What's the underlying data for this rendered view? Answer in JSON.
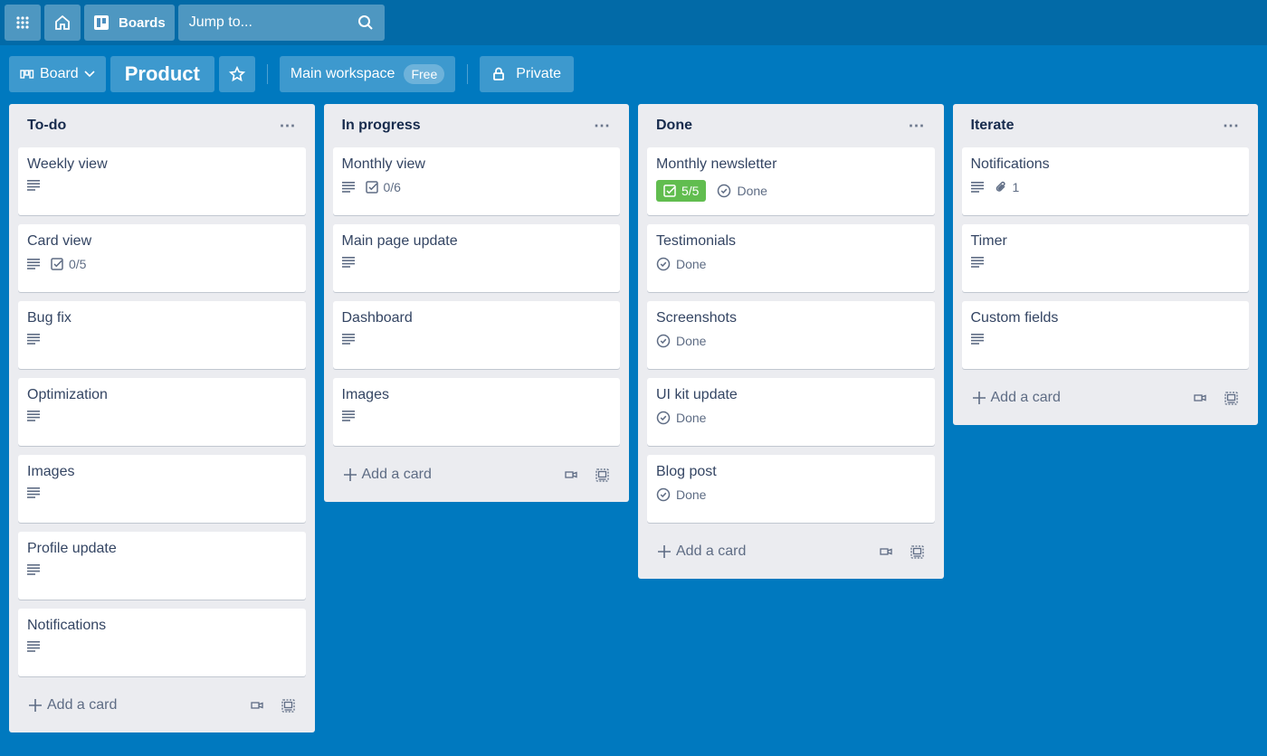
{
  "topbar": {
    "apps_icon": "apps-grid-icon",
    "home_icon": "home-icon",
    "boards_label": "Boards",
    "search_placeholder": "Jump to..."
  },
  "boardbar": {
    "view_label": "Board",
    "title": "Product",
    "workspace_label": "Main workspace",
    "workspace_badge": "Free",
    "visibility_label": "Private"
  },
  "colors": {
    "background": "#0079bf",
    "list_bg": "#ebecf0",
    "checklist_complete": "#61bd4f"
  },
  "lists": [
    {
      "title": "To-do",
      "add_label": "Add a card",
      "cards": [
        {
          "title": "Weekly view",
          "desc": true
        },
        {
          "title": "Card view",
          "desc": true,
          "checklist": "0/5"
        },
        {
          "title": "Bug fix",
          "desc": true
        },
        {
          "title": "Optimization",
          "desc": true
        },
        {
          "title": "Images",
          "desc": true
        },
        {
          "title": "Profile update",
          "desc": true
        },
        {
          "title": "Notifications",
          "desc": true
        }
      ]
    },
    {
      "title": "In progress",
      "add_label": "Add a card",
      "cards": [
        {
          "title": "Monthly view",
          "desc": true,
          "checklist": "0/6"
        },
        {
          "title": "Main page update",
          "desc": true
        },
        {
          "title": "Dashboard",
          "desc": true
        },
        {
          "title": "Images",
          "desc": true
        }
      ]
    },
    {
      "title": "Done",
      "add_label": "Add a card",
      "cards": [
        {
          "title": "Monthly newsletter",
          "checklist": "5/5",
          "checklist_complete": true,
          "status": "Done"
        },
        {
          "title": "Testimonials",
          "status": "Done"
        },
        {
          "title": "Screenshots",
          "status": "Done"
        },
        {
          "title": "UI kit update",
          "status": "Done"
        },
        {
          "title": "Blog post",
          "status": "Done"
        }
      ]
    },
    {
      "title": "Iterate",
      "add_label": "Add a card",
      "cards": [
        {
          "title": "Notifications",
          "desc": true,
          "attachments": "1"
        },
        {
          "title": "Timer",
          "desc": true
        },
        {
          "title": "Custom fields",
          "desc": true
        }
      ]
    }
  ]
}
